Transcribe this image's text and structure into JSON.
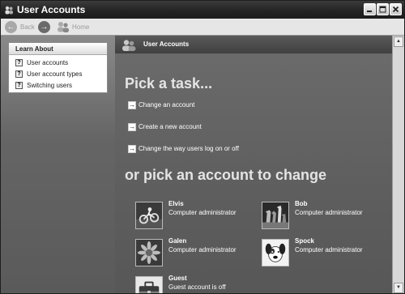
{
  "window": {
    "title": "User Accounts"
  },
  "toolbar": {
    "back": "Back",
    "home": "Home"
  },
  "learn_about": {
    "heading": "Learn About",
    "items": [
      {
        "label": "User accounts"
      },
      {
        "label": "User account types"
      },
      {
        "label": "Switching users"
      }
    ]
  },
  "main": {
    "header_title": "User Accounts",
    "pick_task": "Pick a task...",
    "tasks": [
      {
        "label": "Change an account"
      },
      {
        "label": "Create a new account"
      },
      {
        "label": "Change the way users log on or off"
      }
    ],
    "pick_account": "or pick an account to change",
    "accounts": [
      {
        "name": "Elvis",
        "role": "Computer administrator",
        "picture": "motorbike"
      },
      {
        "name": "Bob",
        "role": "Computer administrator",
        "picture": "chess"
      },
      {
        "name": "Galen",
        "role": "Computer administrator",
        "picture": "flower"
      },
      {
        "name": "Spock",
        "role": "Computer administrator",
        "picture": "dog"
      },
      {
        "name": "Guest",
        "role": "Guest account is off",
        "picture": "briefcase"
      }
    ]
  }
}
